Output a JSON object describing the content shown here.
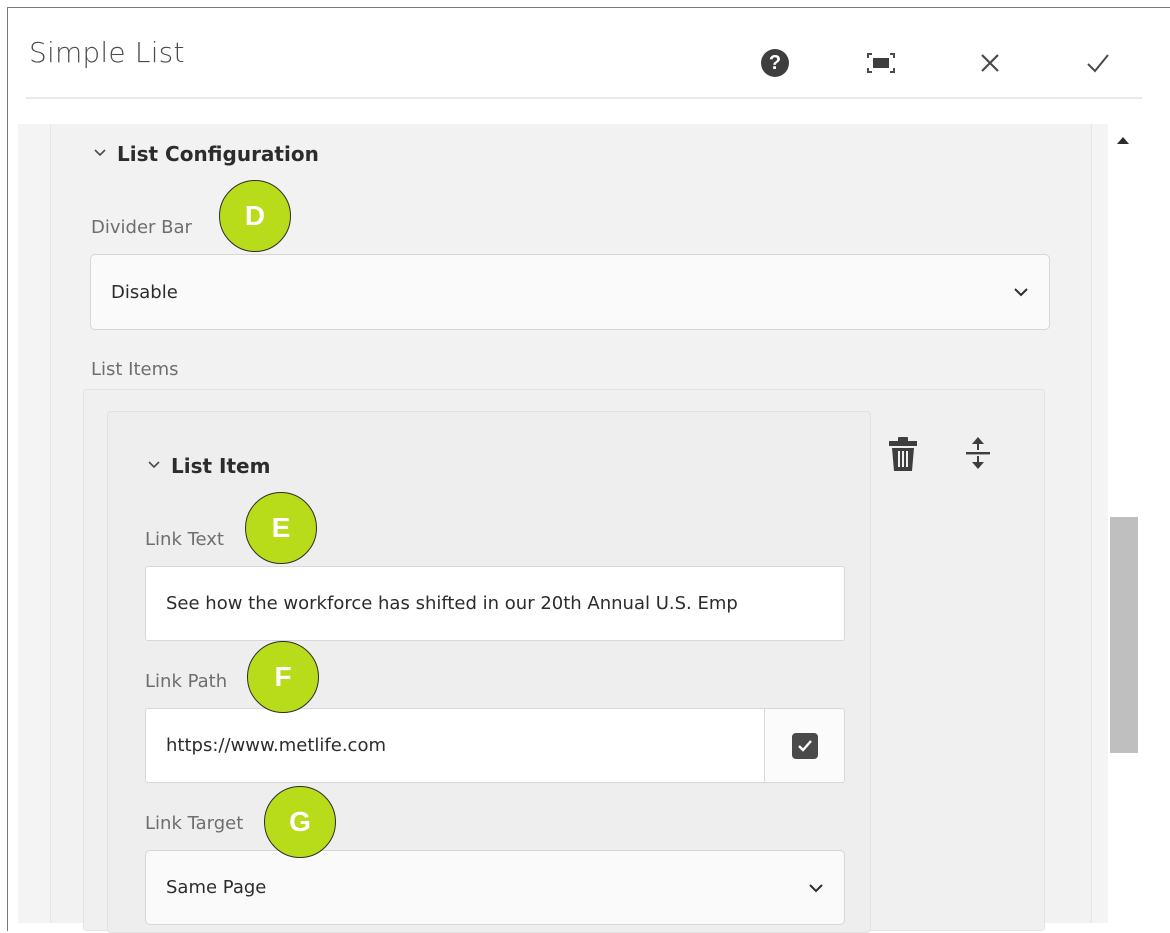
{
  "dialog": {
    "title": "Simple List"
  },
  "header_icons": [
    "help-icon",
    "fullscreen-icon",
    "close-icon",
    "done-icon"
  ],
  "list_configuration": {
    "section_title": "List Configuration",
    "divider_bar": {
      "label": "Divider Bar",
      "value": "Disable"
    },
    "list_items_label": "List Items"
  },
  "list_item": {
    "section_title": "List Item",
    "link_text": {
      "label": "Link Text",
      "value": "See how the workforce has shifted in our 20th Annual U.S. Emp"
    },
    "link_path": {
      "label": "Link Path",
      "value": "https://www.metlife.com"
    },
    "link_target": {
      "label": "Link Target",
      "value": "Same Page"
    }
  },
  "annotations": {
    "d": "D",
    "e": "E",
    "f": "F",
    "g": "G"
  },
  "colors": {
    "badge": "#b8dc19",
    "panel_bg": "#f2f2f2"
  }
}
